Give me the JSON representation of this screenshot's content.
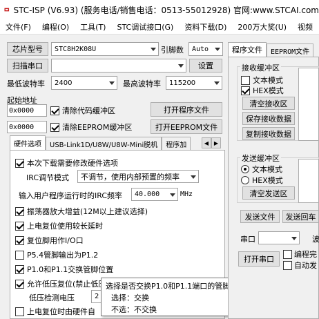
{
  "title": "STC-ISP (V6.93) (服务电话/销售电话：0513-55012928) 官网:www.STCAI.com",
  "menu": [
    "文件(F)",
    "编程(O)",
    "工具(T)",
    "STC调试接口(G)",
    "资料下载(D)",
    "200万大奖(U)",
    "视频"
  ],
  "chip": {
    "label": "芯片型号",
    "value": "STC8H2K08U",
    "pins_label": "引脚数",
    "pins_value": "Auto"
  },
  "scan_button": "扫描串口",
  "settings_button": "设置",
  "min_baud_label": "最低波特率",
  "min_baud_value": "2400",
  "max_baud_label": "最高波特率",
  "max_baud_value": "115200",
  "start_addr_label": "起始地址",
  "addr1": "0x0000",
  "clear_code_label": "清除代码缓冲区",
  "open_program_button": "打开程序文件",
  "addr2": "0x0000",
  "clear_eeprom_label": "清除EEPROM缓冲区",
  "open_eeprom_button": "打开EEPROM文件",
  "hw_tabs": [
    "硬件选项",
    "USB-Link1D/U8W/U8W-Mini脱机",
    "程序加"
  ],
  "options": {
    "opt1": "本次下载需要修改硬件选项",
    "irc_mode_label": "IRC调节模式",
    "irc_mode_value": "不调节，使用内部预置的频率",
    "irc_freq_label": "输入用户程序运行时的IRC频率",
    "irc_freq_value": "40.000",
    "irc_freq_unit": "MHz",
    "opt2": "振荡器放大增益(12M以上建议选择)",
    "opt3": "上电复位使用较长延时",
    "opt4": "复位脚用作I/O口",
    "opt5": "P5.4管脚输出为P1.2",
    "opt6": "P1.0和P1.1交换管脚位置",
    "opt7": "允许低压复位(禁止低压中断)",
    "lv_label": "低压检测电压",
    "lv_value": "2",
    "opt8": "上电复位时由硬件自"
  },
  "tooltip": {
    "line1": "选择是否交换P1.0和P1.1端口的管脚位置",
    "line2": "选择：交换",
    "line3": "不选：不交换"
  },
  "right_tabs": [
    "程序文件",
    "EEPROM文件"
  ],
  "recv": {
    "group": "接收缓冲区",
    "text_mode": "文本模式",
    "hex_mode": "HEX模式",
    "clear": "清空接收区",
    "save": "保存接收数据",
    "copy": "复制接收数据"
  },
  "send": {
    "group": "发送缓冲区",
    "text_mode": "文本模式",
    "hex_mode": "HEX模式",
    "clear": "清空发送区",
    "send_file": "发送文件",
    "send_back": "发送回车"
  },
  "serial_label": "串口",
  "baud_cut": "波",
  "open_port": "打开串口",
  "prog_label": "编程完",
  "auto_label": "自动发",
  "colors": {
    "accent": "#1e64c8",
    "bg": "#f0f0f0"
  }
}
